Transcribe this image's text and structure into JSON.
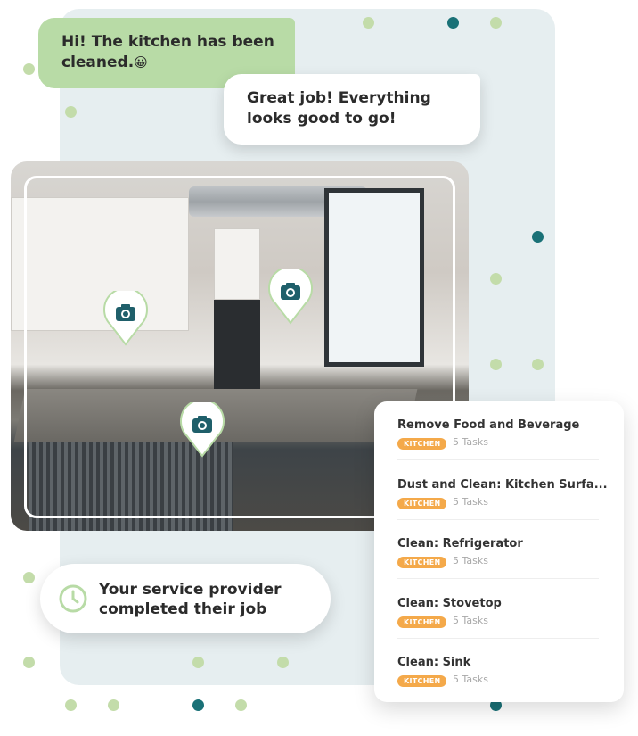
{
  "messages": [
    {
      "sender": "provider",
      "text_line1": "Hi! The kitchen has been",
      "text_line2": "cleaned.",
      "emoji": "😀"
    },
    {
      "sender": "customer",
      "text_line1": "Great job! Everything",
      "text_line2": "looks good to go!"
    }
  ],
  "photo": {
    "pins": [
      "camera-icon",
      "camera-icon",
      "camera-icon"
    ]
  },
  "tasks": [
    {
      "name": "Remove Food and Beverage",
      "room": "KITCHEN",
      "count": "5 Tasks"
    },
    {
      "name": "Dust and Clean: Kitchen Surfa...",
      "room": "KITCHEN",
      "count": "5 Tasks"
    },
    {
      "name": "Clean: Refrigerator",
      "room": "KITCHEN",
      "count": "5 Tasks"
    },
    {
      "name": "Clean: Stovetop",
      "room": "KITCHEN",
      "count": "5 Tasks"
    },
    {
      "name": "Clean: Sink",
      "room": "KITCHEN",
      "count": "5 Tasks"
    }
  ],
  "status": {
    "line1": "Your service provider",
    "line2": "completed their job",
    "icon": "clock-icon"
  },
  "colors": {
    "accent_green": "#b8dba6",
    "teal": "#1a7177",
    "badge": "#f4a94a",
    "panel": "#e6eef0"
  }
}
